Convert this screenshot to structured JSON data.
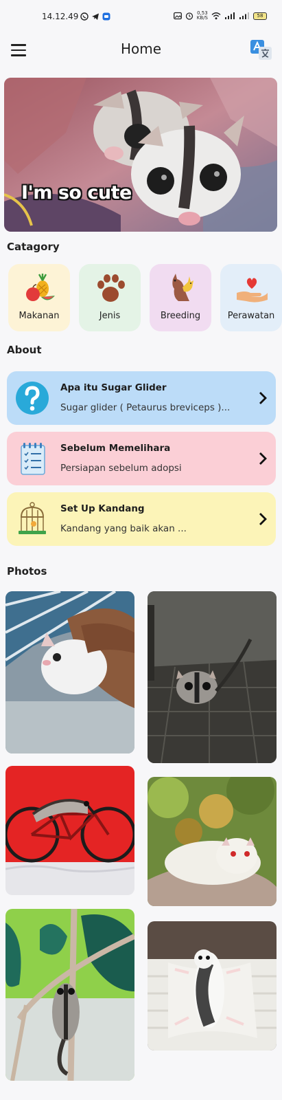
{
  "status_bar": {
    "time": "14.12.49",
    "speed_top": "0,53",
    "speed_bottom": "KB/S",
    "battery": "58"
  },
  "app_bar": {
    "title": "Home",
    "menu_icon": "menu-icon",
    "action_icon": "translate-icon"
  },
  "hero": {
    "caption": "I'm so cute"
  },
  "category": {
    "title": "Catagory",
    "items": [
      {
        "label": "Makanan",
        "icon": "fruit-icon",
        "bg": "#fdf3d6"
      },
      {
        "label": "Jenis",
        "icon": "paw-icon",
        "bg": "#e4f3e6"
      },
      {
        "label": "Breeding",
        "icon": "kangaroo-icon",
        "bg": "#f1dcf1"
      },
      {
        "label": "Perawatan",
        "icon": "heart-hand-icon",
        "bg": "#e3eef9"
      }
    ]
  },
  "about": {
    "title": "About",
    "items": [
      {
        "title": "Apa itu Sugar Glider",
        "subtitle": "Sugar glider ( Petaurus breviceps )...",
        "icon": "question-icon",
        "bg": "#bcdcf8"
      },
      {
        "title": "Sebelum Memelihara",
        "subtitle": "Persiapan sebelum adopsi",
        "icon": "checklist-icon",
        "bg": "#fbcfd6"
      },
      {
        "title": "Set Up Kandang",
        "subtitle": "Kandang yang baik akan ...",
        "icon": "birdcage-icon",
        "bg": "#fcf4b8"
      }
    ]
  },
  "photos": {
    "title": "Photos"
  },
  "colors": {
    "background": "#f7f7f9",
    "text": "#1e1e1e"
  }
}
